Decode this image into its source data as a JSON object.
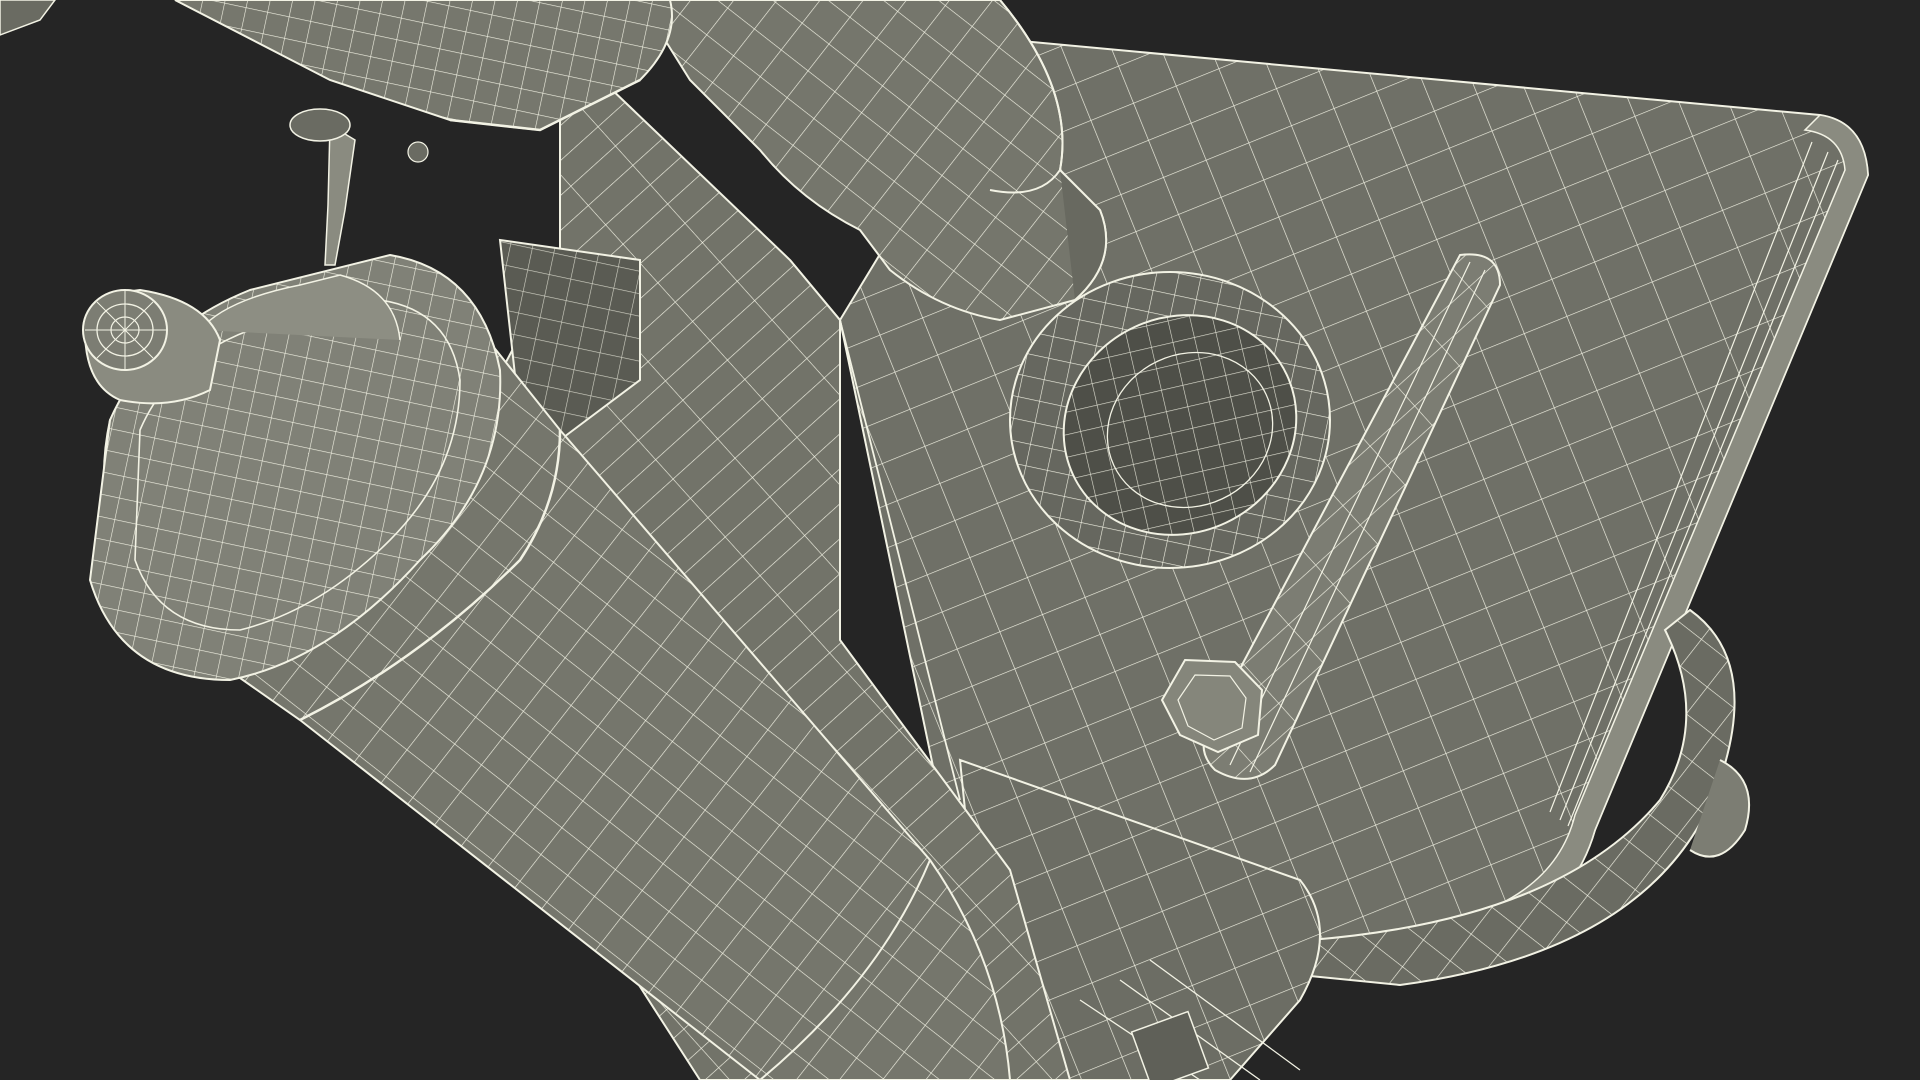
{
  "scene": {
    "subject": "microscope-wireframe-render",
    "colors": {
      "background": "#252525",
      "surface": "#75766c",
      "surface_dark": "#5f6058",
      "surface_shadow": "#4e4f48",
      "surface_light": "#8a8b80",
      "wire": "#f2f2e4"
    }
  }
}
